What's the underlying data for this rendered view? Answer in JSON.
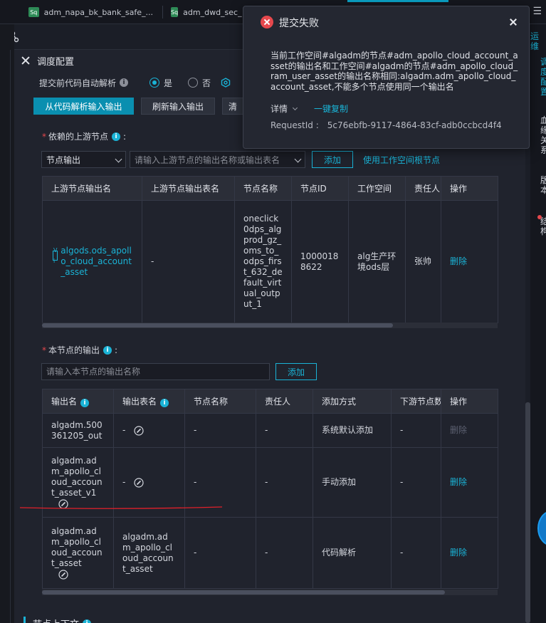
{
  "tabs": [
    {
      "badge": "Sq",
      "label": "adm_napa_bk_bank_safe_..."
    },
    {
      "badge": "Sq",
      "label": "adm_dwd_sec_..."
    }
  ],
  "menu_icon": "hamburger-icon",
  "panel": {
    "title": "调度配置",
    "auto_parse_label": "提交前代码自动解析",
    "auto_parse_options": [
      "是",
      "否"
    ],
    "auto_parse_selected": "是",
    "buttons": {
      "parse_from_code": "从代码解析输入输出",
      "refresh_io": "刷新输入输出",
      "clear": "清"
    }
  },
  "upstream": {
    "label": "依赖的上游节点",
    "select_value": "节点输出",
    "input_placeholder": "请输入上游节点的输出名称或输出表名",
    "add_button": "添加",
    "use_root_link": "使用工作空间根节点",
    "columns": [
      "上游节点输出名",
      "上游节点输出表名",
      "节点名称",
      "节点ID",
      "工作空间",
      "责任人",
      "操作"
    ],
    "rows": [
      {
        "badge": "Vi",
        "output_name": "algods.ods_apollo_cloud_account_asset",
        "output_table": "-",
        "node_name": "oneclick0dps_algprod_gz_oms_to_odps_first_632_default_virtual_output_1",
        "node_id": "10000188622",
        "workspace": "alg生产环境ods层",
        "owner": "张帅",
        "action": "删除"
      }
    ]
  },
  "outputs": {
    "label": "本节点的输出",
    "input_placeholder": "请输入本节点的输出名称",
    "add_button": "添加",
    "columns": [
      "输出名",
      "输出表名",
      "节点名称",
      "责任人",
      "添加方式",
      "下游节点数",
      "操作"
    ],
    "rows": [
      {
        "output_name": "algadm.500361205_out",
        "output_table": "-",
        "node_name": "-",
        "owner": "-",
        "add_method": "系统默认添加",
        "downstream": "-",
        "action": "删除",
        "action_disabled": true
      },
      {
        "output_name": "algadm.adm_apollo_cloud_account_asset_v1",
        "output_table": "-",
        "node_name": "-",
        "owner": "-",
        "add_method": "手动添加",
        "downstream": "-",
        "action": "删除",
        "action_disabled": false
      },
      {
        "output_name": "algadm.adm_apollo_cloud_account_asset",
        "output_table": "algadm.adm_apollo_cloud_account_asset",
        "node_name": "-",
        "owner": "-",
        "add_method": "代码解析",
        "downstream": "-",
        "action": "删除",
        "action_disabled": false
      }
    ]
  },
  "next_section_title": "节点上下文",
  "right_panel": {
    "top_label": "运维",
    "items": [
      "调度配置",
      "血缘关系",
      "版本",
      "结构"
    ]
  },
  "toast": {
    "title": "提交失败",
    "message": "当前工作空间#algadm的节点#adm_apollo_cloud_account_asset的输出名和工作空间#algadm的节点#adm_apollo_cloud_ram_user_asset的输出名称相同:algadm.adm_apollo_cloud_account_asset,不能多个节点使用同一个输出名",
    "detail_label": "详情",
    "copy_link": "一键复制",
    "request_id_label": "RequestId :",
    "request_id": "5c76ebfb-9117-4864-83cf-adb0ccbcd4f4"
  },
  "colors": {
    "accent": "#1ab3d6",
    "error": "#e5484d",
    "primary_button": "#0a8fb0",
    "background": "#1b1e27"
  }
}
